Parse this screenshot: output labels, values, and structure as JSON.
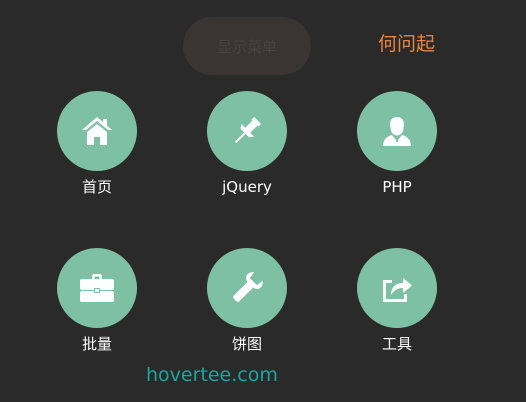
{
  "header": {
    "menu_button_label": "显示菜单",
    "author": "何问起"
  },
  "menu": {
    "items": [
      {
        "label": "首页",
        "icon": "home-icon"
      },
      {
        "label": "jQuery",
        "icon": "pin-icon"
      },
      {
        "label": "PHP",
        "icon": "user-icon"
      },
      {
        "label": "批量",
        "icon": "briefcase-icon"
      },
      {
        "label": "饼图",
        "icon": "wrench-icon"
      },
      {
        "label": "工具",
        "icon": "share-icon"
      }
    ]
  },
  "footer": {
    "watermark": "hovertee.com"
  },
  "colors": {
    "background": "#2b2a2a",
    "circle": "#7ec0a4",
    "author": "#e8843f",
    "watermark": "#1aa5a0"
  }
}
